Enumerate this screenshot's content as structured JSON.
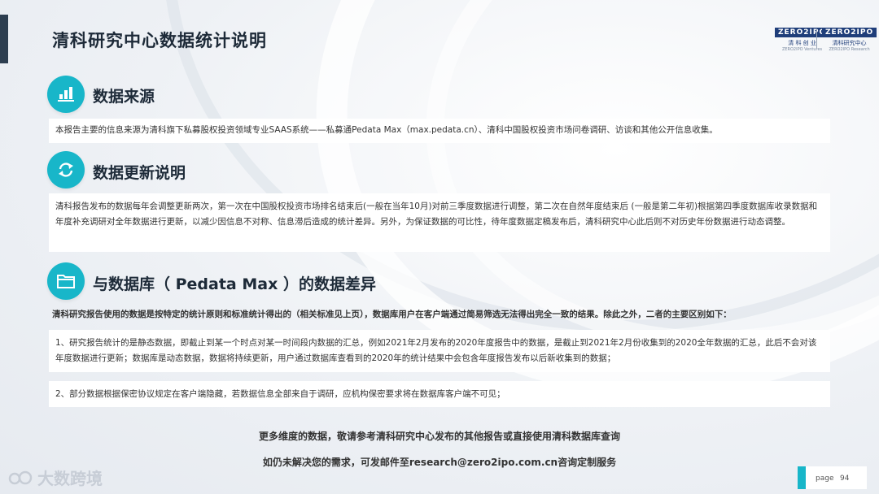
{
  "page_title": "清科研究中心数据统计说明",
  "logos": {
    "logo1_badge": "ZERO2IPO",
    "logo1_name": "清 科 创 业",
    "logo1_en": "ZERO2IPO Ventures",
    "logo2_badge": "ZERO2IPO",
    "logo2_name": "清科研究中心",
    "logo2_en": "ZERO2IPO Research"
  },
  "sections": {
    "source": {
      "title": "数据来源",
      "icon": "bar-chart-icon",
      "text": "本报告主要的信息来源为清科旗下私募股权投资领域专业SAAS系统——私募通Pedata Max（max.pedata.cn）、清科中国股权投资市场问卷调研、访谈和其他公开信息收集。"
    },
    "update": {
      "title": "数据更新说明",
      "icon": "refresh-icon",
      "text": "清科报告发布的数据每年会调整更新两次，第一次在中国股权投资市场排名结束后(一般在当年10月)对前三季度数据进行调整，第二次在自然年度结束后 (一般是第二年初)根据第四季度数据库收录数据和年度补充调研对全年数据进行更新，以减少因信息不对称、信息滞后造成的统计差异。另外，为保证数据的可比性，待年度数据定稿发布后，清科研究中心此后则不对历史年份数据进行动态调整。"
    },
    "diff": {
      "title": "与数据库（ Pedata Max ）的数据差异",
      "icon": "folder-icon",
      "intro": "清科研究报告使用的数据是按特定的统计原则和标准统计得出的（相关标准见上页），数据库用户在客户端通过简易筛选无法得出完全一致的结果。除此之外，二者的主要区别如下：",
      "item1": "1、研究报告统计的是静态数据，即截止到某一个时点对某一时间段内数据的汇总，例如2021年2月发布的2020年度报告中的数据，是截止到2021年2月份收集到的2020全年数据的汇总，此后不会对该年度数据进行更新；数据库是动态数据，数据将持续更新，用户通过数据库查看到的2020年的统计结果中会包含年度报告发布以后新收集到的数据；",
      "item2": "2、部分数据根据保密协议规定在客户端隐藏，若数据信息全部来自于调研，应机构保密要求将在数据库客户端不可见；"
    }
  },
  "footer": {
    "line1": "更多维度的数据，敬请参考清科研究中心发布的其他报告或直接使用清科数据库查询",
    "line2": "如仍未解决您的需求，可发邮件至research@zero2ipo.com.cn咨询定制服务"
  },
  "watermark": "大数跨境",
  "page": {
    "label": "page",
    "number": "94"
  },
  "colors": {
    "accent": "#18b6c9",
    "title": "#1d2a38",
    "dark_bar": "#2d3e50"
  }
}
